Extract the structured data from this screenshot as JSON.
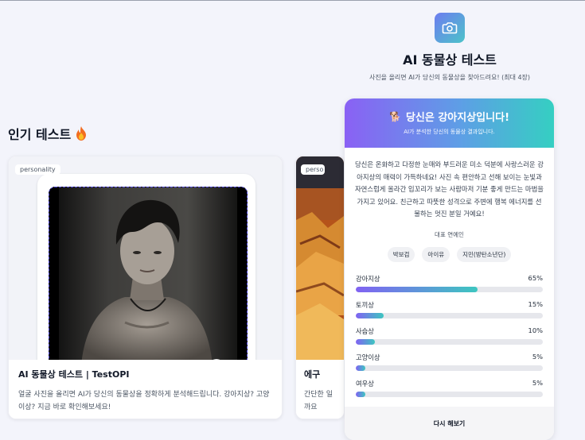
{
  "popular": {
    "title": "인기 테스트",
    "title_icon": "fire-icon",
    "cards": [
      {
        "tag": "personality",
        "title": "AI 동물상 테스트 | TestOPI",
        "desc": "얼굴 사진을 올리면 AI가 당신의 동물상을 정확하게 분석해드립니다. 강아지상? 고양이상? 지금 바로 확인해보세요!"
      },
      {
        "tag": "perso",
        "title": "에구",
        "desc": "간단한 일까요"
      }
    ]
  },
  "app": {
    "icon": "camera-icon",
    "title": "AI 동물상 테스트",
    "subtitle": "사진을 올리면 AI가 당신의 동물상을 찾아드려요! (최대 4장)"
  },
  "result": {
    "emoji": "🐕",
    "title": "당신은 강아지상입니다!",
    "subtitle": "AI가 분석한 당신의 동물상 결과입니다.",
    "description": "당신은 온화하고 다정한 눈매와 부드러운 미소 덕분에 사랑스러운 강아지상의 매력이 가득하네요! 사진 속 편안하고 선해 보이는 눈빛과 자연스럽게 올라간 입꼬리가 보는 사람마저 기분 좋게 만드는 마법을 가지고 있어요. 친근하고 따뜻한 성격으로 주변에 행복 에너지를 선물하는 멋진 분일 거예요!",
    "celeb_label": "대표 연예인",
    "celebs": [
      "박보검",
      "아이유",
      "지민(방탄소년단)"
    ],
    "scores": [
      {
        "label": "강아지상",
        "value": 65,
        "text": "65%"
      },
      {
        "label": "토끼상",
        "value": 15,
        "text": "15%"
      },
      {
        "label": "사슴상",
        "value": 10,
        "text": "10%"
      },
      {
        "label": "고양이상",
        "value": 5,
        "text": "5%"
      },
      {
        "label": "여우상",
        "value": 5,
        "text": "5%"
      }
    ],
    "retry": "다시 해보기"
  }
}
